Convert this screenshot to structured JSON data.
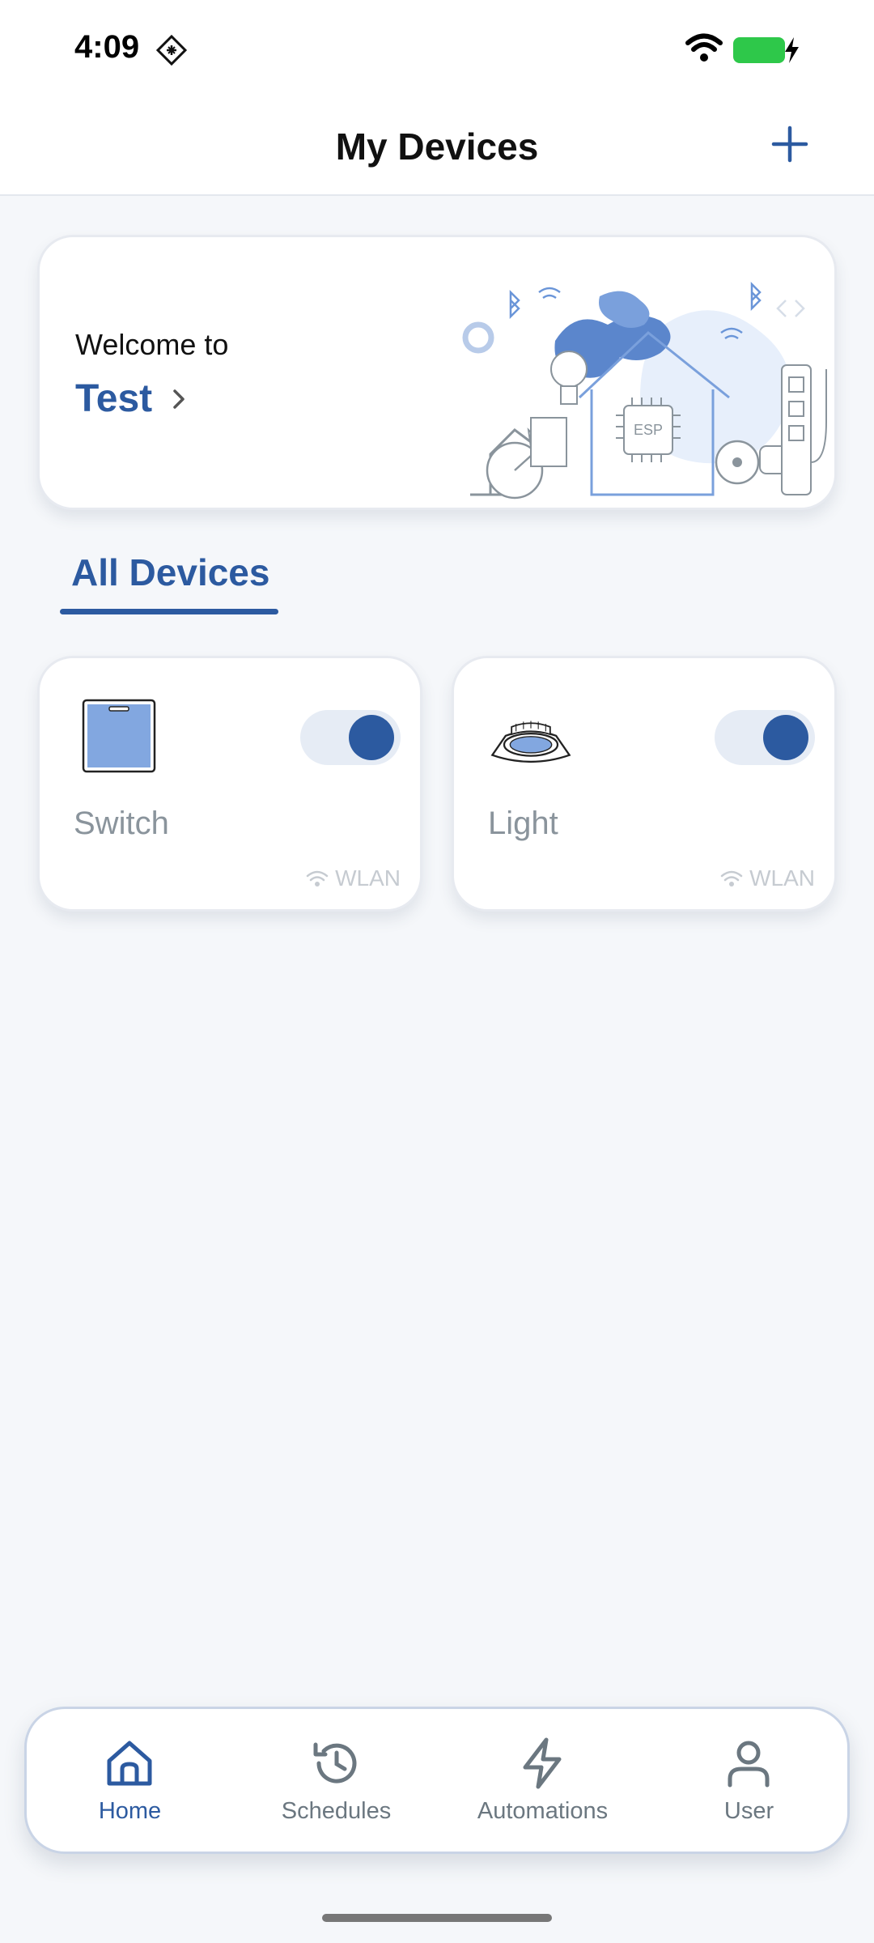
{
  "status_bar": {
    "time": "4:09",
    "app_icon": "diamond-grid-icon",
    "wifi_icon": "wifi-icon",
    "battery_icon": "battery-charging-icon",
    "battery_color": "#2ec84a"
  },
  "header": {
    "title": "My Devices",
    "add_icon": "plus-icon"
  },
  "welcome": {
    "greeting": "Welcome to",
    "home_name": "Test",
    "illustration": "smart-home-illustration"
  },
  "tabs": [
    {
      "label": "All Devices",
      "selected": true
    }
  ],
  "devices": [
    {
      "name": "Switch",
      "icon": "switch-device-icon",
      "power_on": true,
      "connection": "WLAN"
    },
    {
      "name": "Light",
      "icon": "light-device-icon",
      "power_on": true,
      "connection": "WLAN"
    }
  ],
  "bottom_nav": [
    {
      "label": "Home",
      "icon": "home-icon",
      "active": true
    },
    {
      "label": "Schedules",
      "icon": "schedules-history-icon",
      "active": false
    },
    {
      "label": "Automations",
      "icon": "lightning-icon",
      "active": false
    },
    {
      "label": "User",
      "icon": "user-icon",
      "active": false
    }
  ],
  "colors": {
    "accent": "#2c5aa0",
    "background": "#f5f7fa",
    "muted_text": "#8a949c"
  }
}
